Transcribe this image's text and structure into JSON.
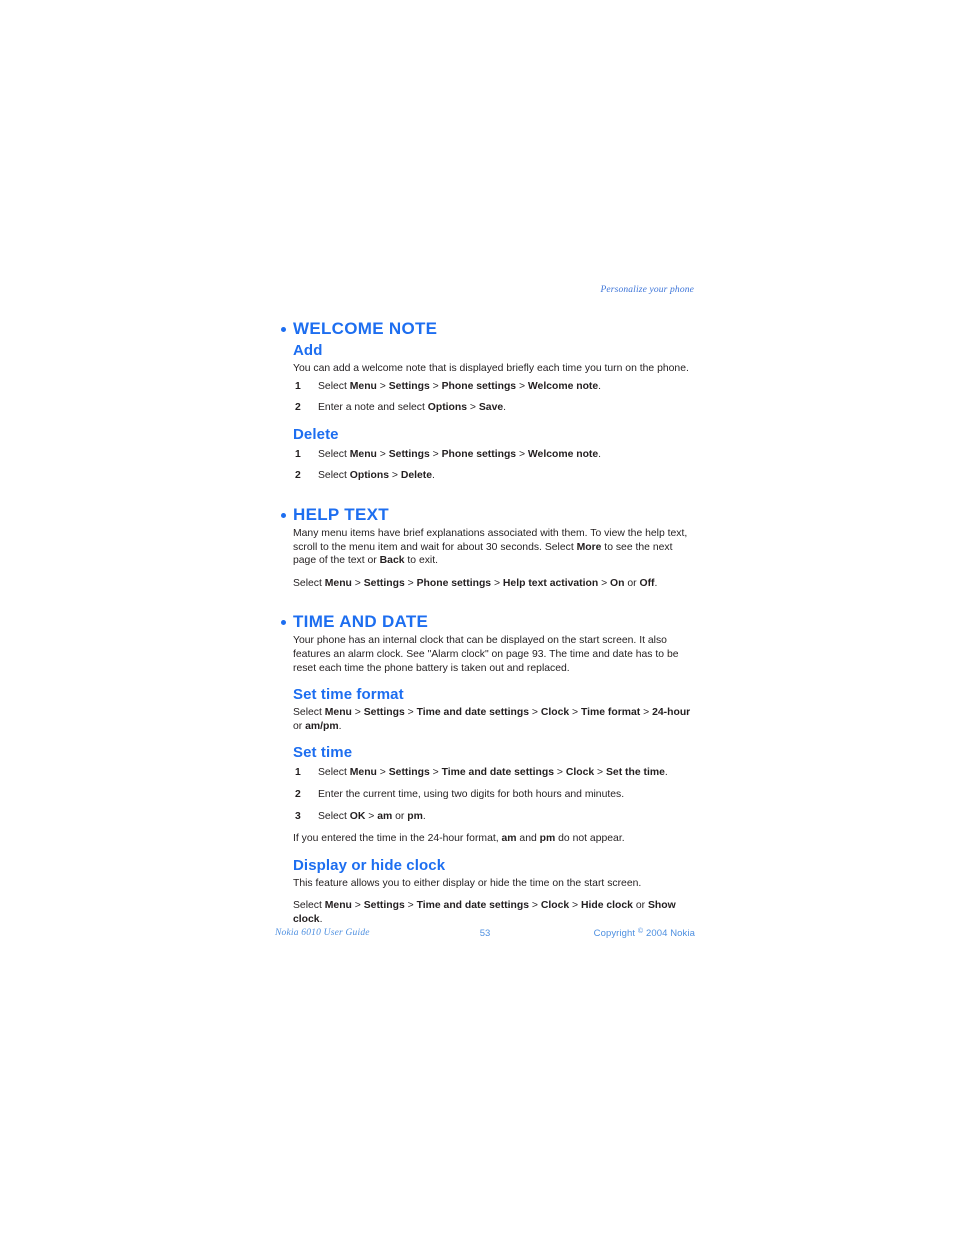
{
  "running_head": "Personalize your phone",
  "sections": [
    {
      "title": "WELCOME NOTE",
      "subsections": [
        {
          "title": "Add",
          "paragraph": "You can add a welcome note that is displayed briefly each time you turn on the phone.",
          "steps": [
            {
              "num": "1",
              "text": "Select Menu > Settings > Phone settings > Welcome note."
            },
            {
              "num": "2",
              "text": "Enter a note and select Options > Save."
            }
          ]
        },
        {
          "title": "Delete",
          "steps": [
            {
              "num": "1",
              "text": "Select Menu > Settings > Phone settings > Welcome note."
            },
            {
              "num": "2",
              "text": "Select Options > Delete."
            }
          ]
        }
      ]
    },
    {
      "title": "HELP TEXT",
      "paragraph": "Many menu items have brief explanations associated with them. To view the help text, scroll to the menu item and wait for about 30 seconds. Select More to see the next page of the text or Back to exit.",
      "paragraph2": "Select Menu > Settings > Phone settings > Help text activation > On or Off."
    },
    {
      "title": "TIME AND DATE",
      "paragraph": "Your phone has an internal clock that can be displayed on the start screen. It also features an alarm clock. See \"Alarm clock\" on page 93. The time and date has to be reset each time the phone battery is taken out and replaced.",
      "subsections": [
        {
          "title": "Set time format",
          "paragraph": "Select Menu > Settings > Time and date settings > Clock > Time format > 24-hour or am/pm."
        },
        {
          "title": "Set time",
          "steps": [
            {
              "num": "1",
              "text": "Select Menu > Settings > Time and date settings > Clock > Set the time."
            },
            {
              "num": "2",
              "text": "Enter the current time, using two digits for both hours and minutes."
            },
            {
              "num": "3",
              "text": "Select OK > am or pm."
            }
          ],
          "paragraph_after": "If you entered the time in the 24-hour format, am and pm do not appear."
        },
        {
          "title": "Display or hide clock",
          "paragraph": "This feature allows you to either display or hide the time on the start screen.",
          "paragraph2": "Select Menu > Settings > Time and date settings > Clock > Hide clock or Show clock."
        }
      ]
    }
  ],
  "footer": {
    "left": "Nokia 6010 User Guide",
    "page_number": "53",
    "right_prefix": "Copyright",
    "right_symbol": "©",
    "right_suffix": "2004 Nokia"
  },
  "colors": {
    "heading_blue": "#1d6ef0",
    "running_head_blue": "#3c74d8",
    "footer_blue": "#4d8fe0",
    "body_text": "#231f20"
  },
  "rich": {
    "welcome_add_step1": "Select <b>Menu</b> > <b>Settings</b> > <b>Phone settings</b> > <b>Welcome note</b>.",
    "welcome_add_step2": "Enter a note and select <b>Options</b> > <b>Save</b>.",
    "welcome_delete_step1": "Select <b>Menu</b> > <b>Settings</b> > <b>Phone settings</b> > <b>Welcome note</b>.",
    "welcome_delete_step2": "Select <b>Options</b> > <b>Delete</b>.",
    "help_para": "Many menu items have brief explanations associated with them. To view the help text, scroll to the menu item and wait for about 30 seconds. Select <b>More</b> to see the next page of the text or <b>Back</b> to exit.",
    "help_para2": "Select <b>Menu</b> > <b>Settings</b> > <b>Phone settings</b> > <b>Help text activation</b> > <b>On</b> or <b>Off</b>.",
    "time_para": "Your phone has an internal clock that can be displayed on the start screen. It also features an alarm clock. See \"Alarm clock\" on page 93. The time and date has to be reset each time the phone battery is taken out and replaced.",
    "set_time_format_para": "Select <b>Menu</b> > <b>Settings</b> > <b>Time and date settings</b> > <b>Clock</b> > <b>Time format</b> > <b>24-hour</b> or <b>am/pm</b>.",
    "set_time_step1": "Select <b>Menu</b> > <b>Settings</b> > <b>Time and date settings</b> > <b>Clock</b> > <b>Set the time</b>.",
    "set_time_step2": "Enter the current time, using two digits for both hours and minutes.",
    "set_time_step3": "Select <b>OK</b> > <b>am</b> or <b>pm</b>.",
    "set_time_after": "If you entered the time in the 24-hour format, <b>am</b> and <b>pm</b> do not appear.",
    "display_clock_para": "This feature allows you to either display or hide the time on the start screen.",
    "display_clock_para2": "Select <b>Menu</b> > <b>Settings</b> > <b>Time and date settings</b> > <b>Clock</b> > <b>Hide clock</b> or <b>Show clock</b>."
  }
}
